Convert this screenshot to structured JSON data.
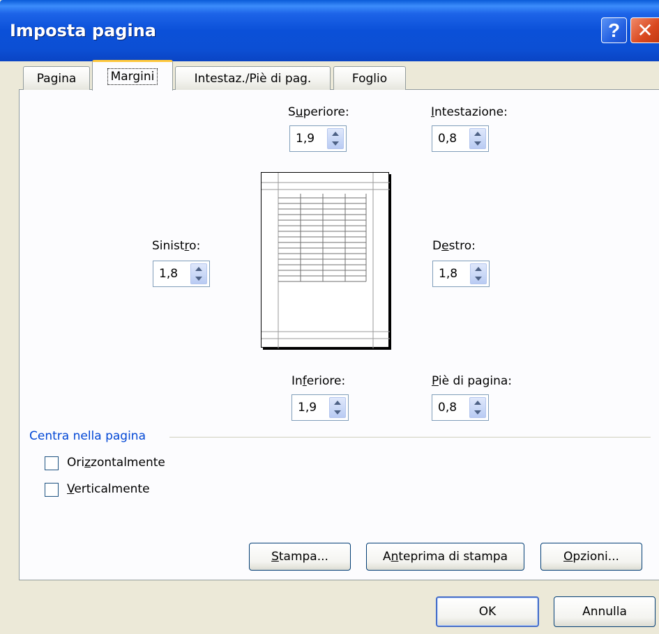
{
  "window": {
    "title": "Imposta pagina"
  },
  "titlebar": {
    "help_glyph": "?",
    "close_glyph": "✕"
  },
  "tabs": [
    {
      "label": "Pagina"
    },
    {
      "label": "Margini"
    },
    {
      "label": "Intestaz./Piè di pag."
    },
    {
      "label": "Foglio"
    }
  ],
  "margins": {
    "superiore": {
      "label_pre": "S",
      "label_acc": "u",
      "label_post": "periore:",
      "value": "1,9"
    },
    "intestazione": {
      "label_pre": "",
      "label_acc": "I",
      "label_post": "ntestazione:",
      "value": "0,8"
    },
    "sinistro": {
      "label_pre": "Sinist",
      "label_acc": "r",
      "label_post": "o:",
      "value": "1,8"
    },
    "destro": {
      "label_pre": "D",
      "label_acc": "e",
      "label_post": "stro:",
      "value": "1,8"
    },
    "inferiore": {
      "label_pre": "In",
      "label_acc": "f",
      "label_post": "eriore:",
      "value": "1,9"
    },
    "pie": {
      "label_pre": "",
      "label_acc": "P",
      "label_post": "iè di pagina:",
      "value": "0,8"
    }
  },
  "center": {
    "group_label": "Centra nella pagina",
    "horizontal": {
      "label_pre": "Ori",
      "label_acc": "z",
      "label_post": "zontalmente",
      "checked": false
    },
    "vertical": {
      "label_pre": "",
      "label_acc": "V",
      "label_post": "erticalmente",
      "checked": false
    }
  },
  "buttons": {
    "stampa": {
      "label_pre": "",
      "label_acc": "S",
      "label_post": "tampa..."
    },
    "anteprima": {
      "label_pre": "A",
      "label_acc": "n",
      "label_post": "teprima di stampa"
    },
    "opzioni": {
      "label_pre": "",
      "label_acc": "O",
      "label_post": "pzioni..."
    },
    "ok": "OK",
    "annulla": "Annulla"
  },
  "colors": {
    "titlebar": "#0b50d8",
    "group_label": "#0046d5",
    "tab_highlight": "#ffc83c",
    "dialog_bg": "#ece9d8"
  }
}
